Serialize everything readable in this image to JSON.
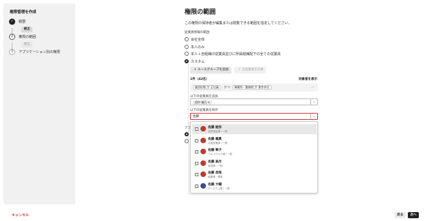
{
  "sidebar": {
    "title": "権限管理を作成",
    "steps": [
      {
        "number": "✓",
        "label": "概要",
        "button": "修正"
      },
      {
        "number": "2",
        "label": "権限の範囲",
        "button": "修正"
      },
      {
        "number": "3",
        "label": "アプリケーション別の権限"
      }
    ]
  },
  "footer": {
    "cancel": "キャンセル",
    "back": "戻る",
    "next": "次へ"
  },
  "main": {
    "title": "権限の範囲",
    "description": "この権限の保持者が編集または閲覧できる範囲を指定してください。",
    "section_label": "従業員情報の範囲",
    "options": [
      {
        "label": "会社全体",
        "selected": false
      },
      {
        "label": "本人のみ",
        "selected": false
      },
      {
        "label": "本人＋自組織の従業員並びに所属組織配下の全ての従業員",
        "selected": false
      },
      {
        "label": "カスタム",
        "selected": true
      }
    ],
    "add_rule_group": "＋ ルールグループを追加",
    "add_all": "＋ 全従業員を対象",
    "count": "1件（42名）",
    "show_targets": "対象者を表示",
    "rule": {
      "chip1": "雇用形態 が 正社員",
      "connector": "かつ",
      "chip2": "事業所・勤務地 が 東京本社",
      "more": "…"
    },
    "add_label": "以下の従業員を追加",
    "added_employee": "田中 美乃 ×",
    "exclude_label": "以下の従業員を除外",
    "exclude_input_value": "佐藤",
    "caret": "⌄",
    "app_label_partial": "アプ",
    "dropdown": [
      {
        "name": "佐藤 絵奈",
        "sub": "品質保証課｜一般",
        "color": "#c0392b"
      },
      {
        "name": "佐藤 颯真",
        "sub": "大阪営業課｜一般",
        "color": "#c0392b"
      },
      {
        "name": "佐藤 華子",
        "sub": "ヘルプデスク課｜一般",
        "color": "#c0392b"
      },
      {
        "name": "佐藤 美月",
        "sub": "採用課｜一般",
        "color": "#c0392b"
      },
      {
        "name": "佐藤 虎哉",
        "sub": "総務課｜課長",
        "color": "#c0392b"
      },
      {
        "name": "佐藤 大輔",
        "sub": "ITシステム課｜一般",
        "color": "#3b4c9b"
      }
    ]
  }
}
